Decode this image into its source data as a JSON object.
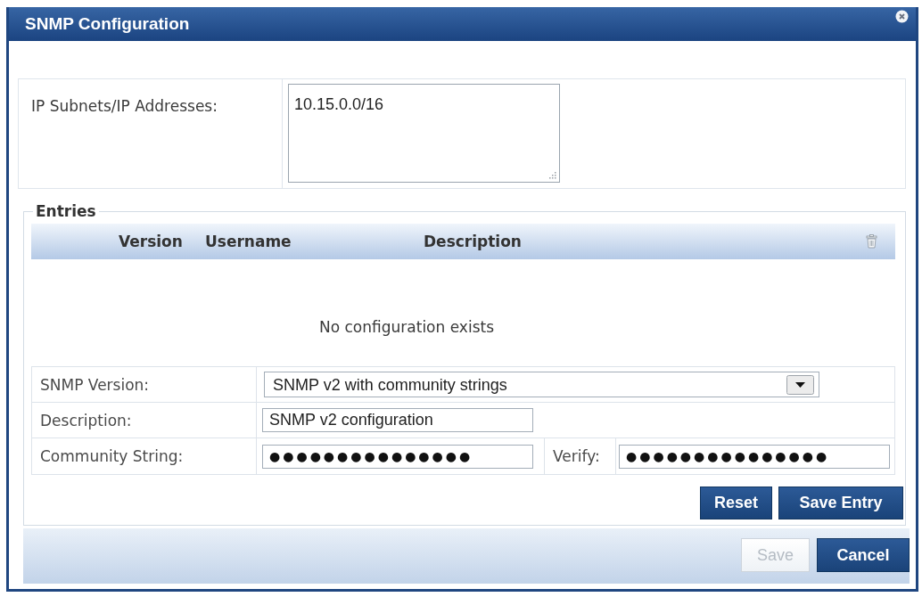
{
  "dialog": {
    "title": "SNMP Configuration"
  },
  "ip_section": {
    "label": "IP Subnets/IP Addresses:",
    "value": "10.15.0.0/16"
  },
  "entries": {
    "legend": "Entries",
    "columns": [
      "Version",
      "Username",
      "Description"
    ],
    "empty_message": "No configuration exists"
  },
  "form": {
    "fields": [
      {
        "kind": "select",
        "label": "SNMP Version:",
        "value": "SNMP v2 with community strings"
      },
      {
        "kind": "text",
        "label": "Description:",
        "value": "SNMP v2 configuration"
      },
      {
        "kind": "password_pair",
        "label": "Community String:",
        "value": "●●●●●●●●●●●●●●●",
        "verify_label": "Verify:",
        "verify_value": "●●●●●●●●●●●●●●●"
      }
    ],
    "buttons": [
      {
        "label": "Reset"
      },
      {
        "label": "Save Entry"
      }
    ]
  },
  "footer": {
    "buttons": [
      {
        "label": "Save",
        "disabled": true
      },
      {
        "label": "Cancel",
        "disabled": false
      }
    ]
  }
}
